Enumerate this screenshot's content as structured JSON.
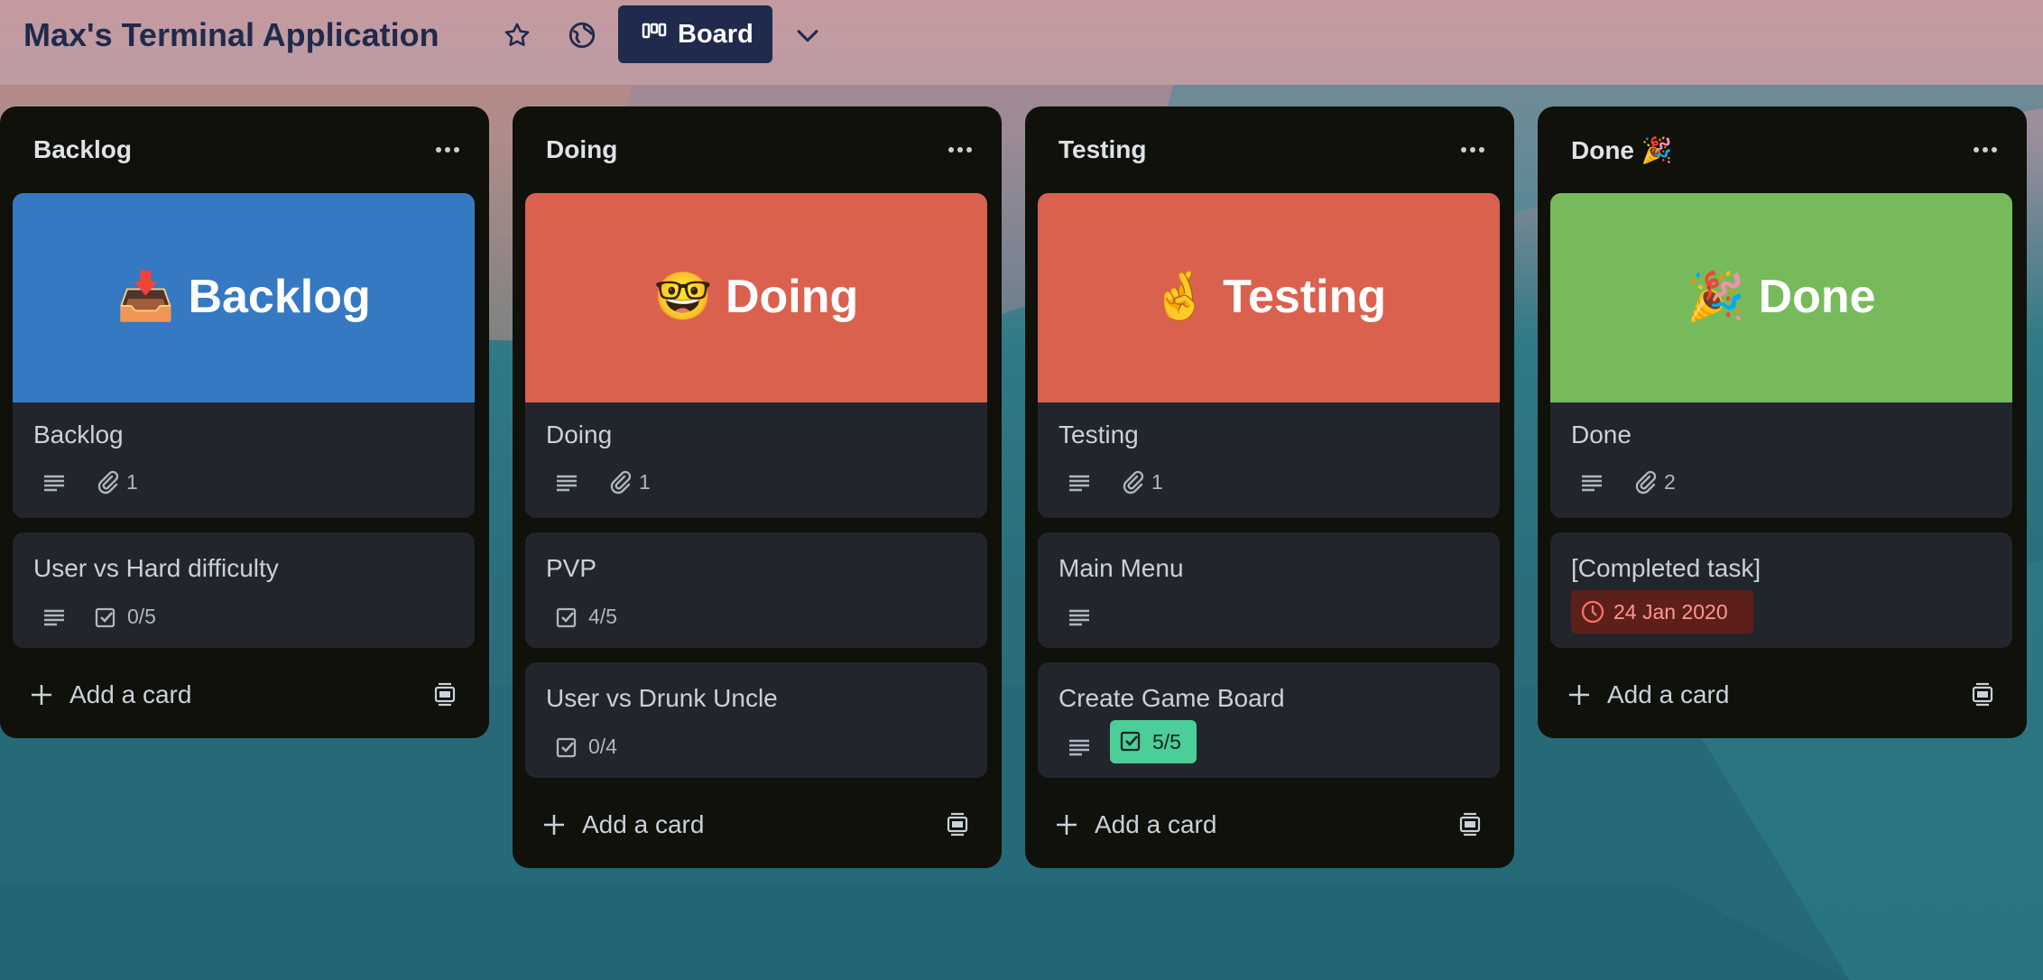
{
  "board": {
    "title": "Max's Terminal Application",
    "view_label": "Board"
  },
  "add_card_label": "Add a card",
  "lists": [
    {
      "title": "Backlog",
      "cards": [
        {
          "cover_text": "📥 Backlog",
          "cover_color": "#3479c2",
          "title": "Backlog",
          "attachments": "1"
        },
        {
          "title": "User vs Hard difficulty",
          "checklist": "0/5"
        }
      ]
    },
    {
      "title": "Doing",
      "cards": [
        {
          "cover_text": "🤓 Doing",
          "cover_color": "#db614f",
          "title": "Doing",
          "attachments": "1"
        },
        {
          "title": "PVP",
          "checklist": "4/5"
        },
        {
          "title": "User vs Drunk Uncle",
          "checklist": "0/4"
        }
      ]
    },
    {
      "title": "Testing",
      "cards": [
        {
          "cover_text": "🤞 Testing",
          "cover_color": "#db614f",
          "title": "Testing",
          "attachments": "1"
        },
        {
          "title": "Main Menu"
        },
        {
          "title": "Create Game Board",
          "checklist": "5/5",
          "checklist_complete_color": "#4bce97"
        }
      ]
    },
    {
      "title": "Done 🎉",
      "cards": [
        {
          "cover_text": "🎉 Done",
          "cover_color": "#77ba5b",
          "title": "Done",
          "attachments": "2"
        },
        {
          "title": "[Completed task]",
          "due_date": "24 Jan 2020",
          "due_color": "#5d1f1a"
        }
      ]
    }
  ]
}
